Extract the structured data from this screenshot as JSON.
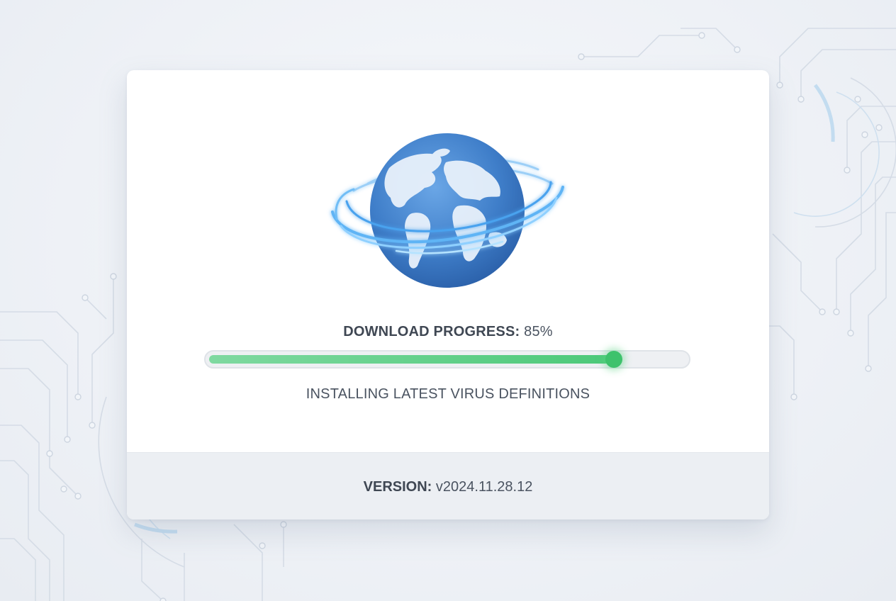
{
  "dialog": {
    "progress_label": "DOWNLOAD PROGRESS:",
    "progress_value_text": "85%",
    "progress_fraction": 0.85,
    "status": "INSTALLING LATEST VIRUS DEFINITIONS",
    "version_label": "VERSION:",
    "version_value": "v2024.11.28.12"
  },
  "icons": {
    "hero": "globe-icon"
  },
  "colors": {
    "progress_fill": "#4cc979",
    "globe_blue": "#3f7ec9",
    "orbit_glow": "#5fb4f5"
  }
}
